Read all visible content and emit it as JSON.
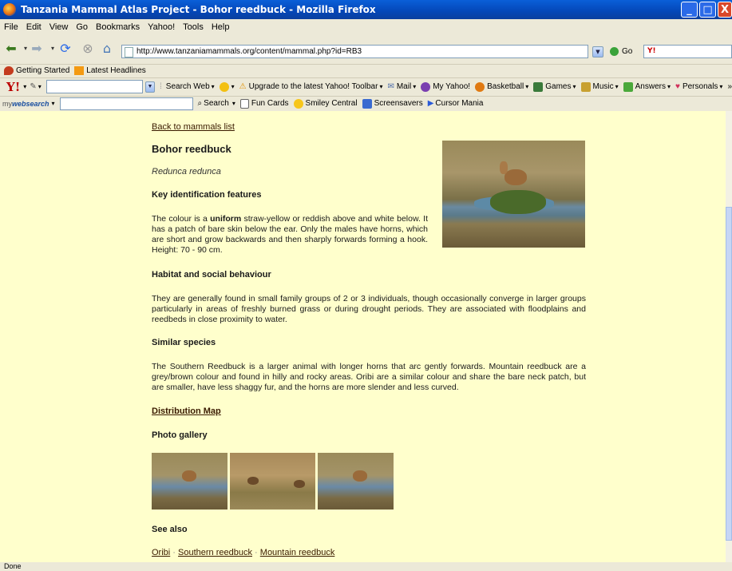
{
  "window": {
    "title": "Tanzania Mammal Atlas Project - Bohor reedbuck - Mozilla Firefox",
    "minimize": "_",
    "maximize": "□",
    "close": "X"
  },
  "menu": [
    "File",
    "Edit",
    "View",
    "Go",
    "Bookmarks",
    "Yahoo!",
    "Tools",
    "Help"
  ],
  "nav": {
    "url": "http://www.tanzaniamammals.org/content/mammal.php?id=RB3",
    "go_label": "Go",
    "yahoo_search_mark": "Y!"
  },
  "bookmarks": [
    "Getting Started",
    "Latest Headlines"
  ],
  "yahoo_toolbar": {
    "logo": "Y!",
    "search_web": "Search Web",
    "upgrade": "Upgrade to the latest Yahoo! Toolbar",
    "mail": "Mail",
    "my_yahoo": "My Yahoo!",
    "basketball": "Basketball",
    "games": "Games",
    "music": "Music",
    "answers": "Answers",
    "personals": "Personals",
    "more": "»"
  },
  "websearch_toolbar": {
    "brand_prefix": "my",
    "brand_main": "websearch",
    "search": "Search",
    "fun_cards": "Fun Cards",
    "smiley": "Smiley Central",
    "screensavers": "Screensavers",
    "cursor": "Cursor Mania"
  },
  "page": {
    "back_link": "Back to mammals list",
    "title": "Bohor reedbuck",
    "scientific": "Redunca redunca",
    "key_heading": "Key identification features",
    "key_text_pre": "The colour is a ",
    "key_text_bold": "uniform",
    "key_text_post": " straw-yellow or reddish above and white below. It has a patch of bare skin below the ear. Only the males have horns, which are short and grow backwards and then sharply forwards forming a hook. Height: 70 - 90 cm.",
    "habitat_heading": "Habitat and social behaviour",
    "habitat_text": "They are generally found in small family groups of 2 or 3 individuals, though occasionally converge in larger groups particularly in areas of freshly burned grass or during drought periods. They are associated with floodplains and reedbeds in close proximity to water.",
    "similar_heading": "Similar species",
    "similar_text": "The Southern Reedbuck is a larger animal with longer horns that arc gently forwards. Mountain reedbuck are a grey/brown colour and found in hilly and rocky areas. Oribi are a similar colour and share the bare neck patch, but are smaller, have less shaggy fur, and the horns are more slender and less curved.",
    "distribution_link": "Distribution Map",
    "gallery_heading": "Photo gallery",
    "see_also_heading": "See also",
    "see_also": [
      "Oribi",
      "Southern reedbuck",
      "Mountain reedbuck"
    ],
    "separator": "·"
  },
  "status": "Done",
  "colors": {
    "page_bg": "#ffffcc",
    "link": "#3a1a00",
    "chrome": "#ece9d8",
    "titlebar": "#0447b8"
  }
}
